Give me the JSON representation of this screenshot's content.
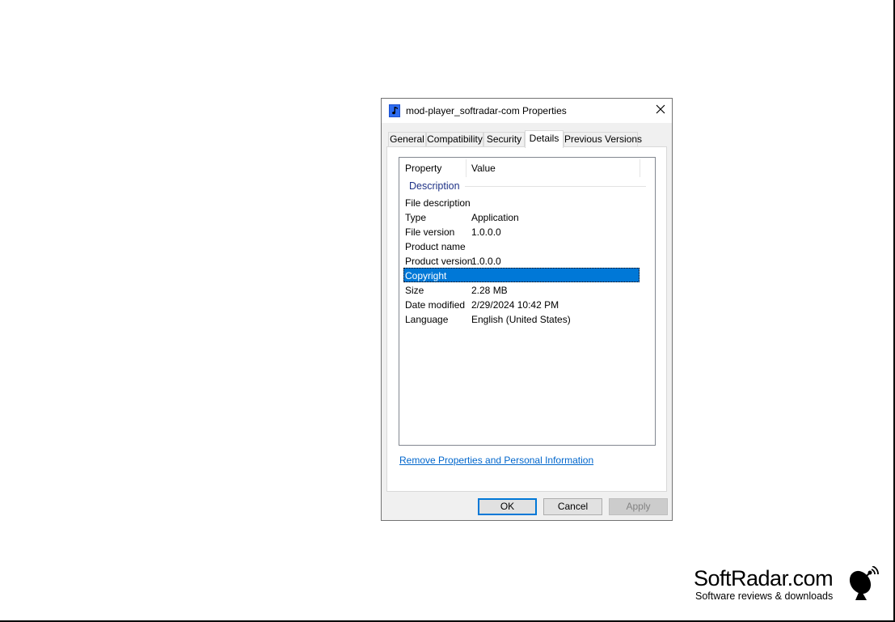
{
  "dialog": {
    "title": "mod-player_softradar-com Properties",
    "icon": "music-file-icon",
    "close_icon": "close-icon"
  },
  "tabs": [
    {
      "label": "General",
      "active": false
    },
    {
      "label": "Compatibility",
      "active": false
    },
    {
      "label": "Security",
      "active": false
    },
    {
      "label": "Details",
      "active": true
    },
    {
      "label": "Previous Versions",
      "active": false
    }
  ],
  "details": {
    "columns": {
      "property": "Property",
      "value": "Value"
    },
    "group": "Description",
    "rows": [
      {
        "property": "File description",
        "value": ""
      },
      {
        "property": "Type",
        "value": "Application"
      },
      {
        "property": "File version",
        "value": "1.0.0.0"
      },
      {
        "property": "Product name",
        "value": ""
      },
      {
        "property": "Product version",
        "value": "1.0.0.0"
      },
      {
        "property": "Copyright",
        "value": "",
        "selected": true
      },
      {
        "property": "Size",
        "value": "2.28 MB"
      },
      {
        "property": "Date modified",
        "value": "2/29/2024 10:42 PM"
      },
      {
        "property": "Language",
        "value": "English (United States)"
      }
    ]
  },
  "remove_link": "Remove Properties and Personal Information",
  "buttons": {
    "ok": "OK",
    "cancel": "Cancel",
    "apply": "Apply"
  },
  "watermark": {
    "brand": "SoftRadar.com",
    "tagline": "Software reviews & downloads",
    "icon": "satellite-dish-icon"
  },
  "colors": {
    "selection": "#0078d7",
    "link": "#0066cc",
    "group_header": "#1e3287"
  }
}
